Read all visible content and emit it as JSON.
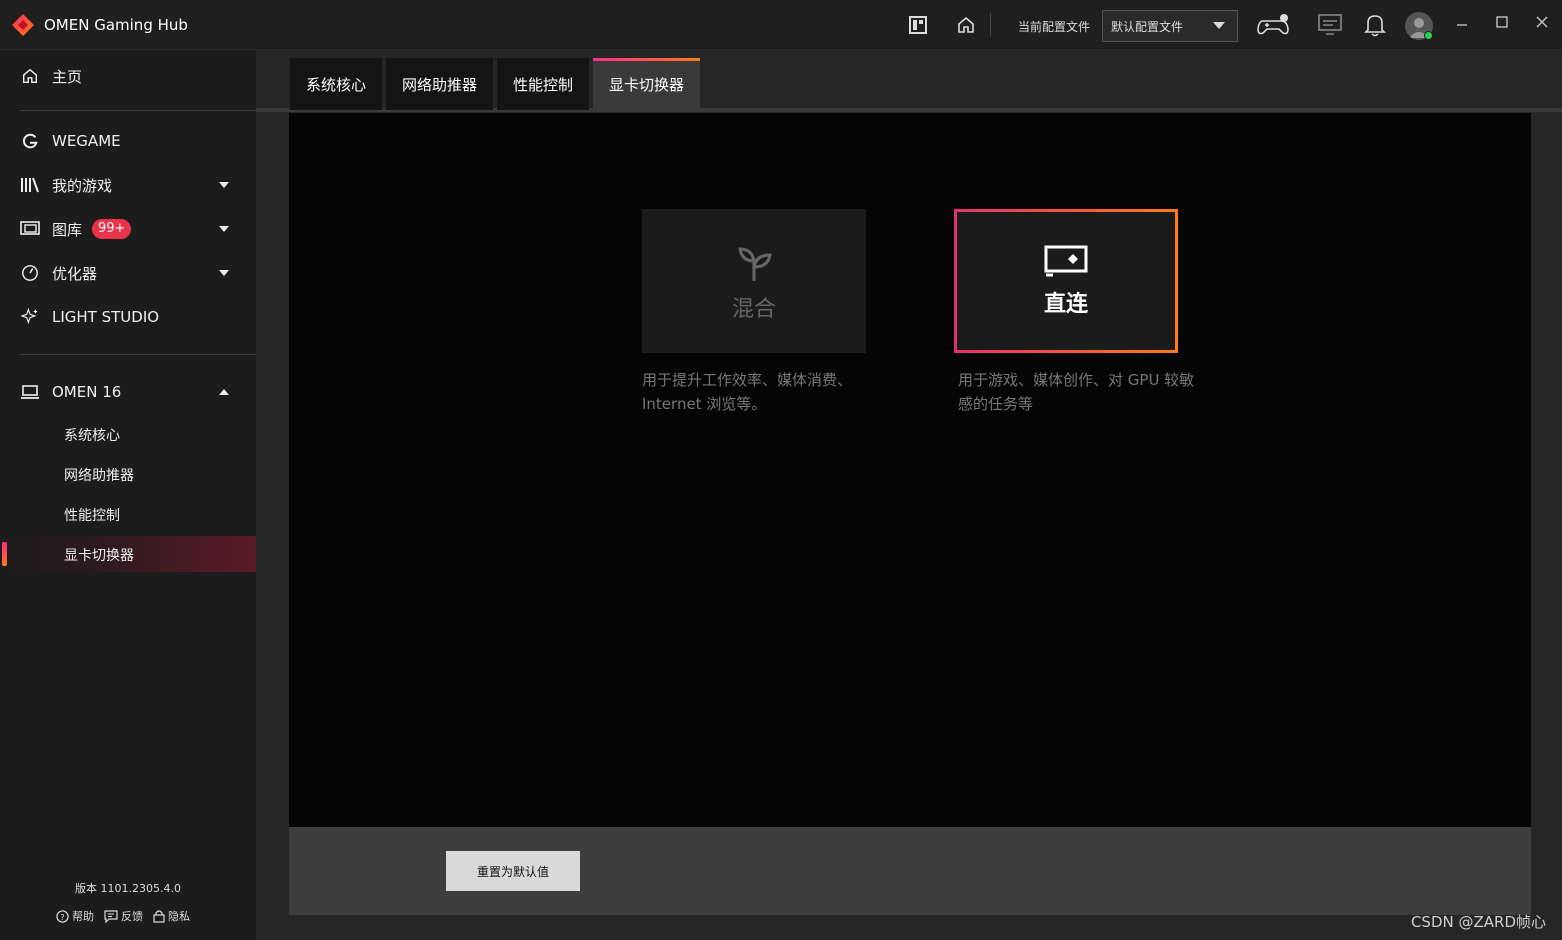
{
  "app": {
    "title": "OMEN Gaming Hub"
  },
  "header": {
    "profile_label": "当前配置文件",
    "profile_value": "默认配置文件"
  },
  "sidebar": {
    "home": "主页",
    "items": [
      {
        "label": "WEGAME"
      },
      {
        "label": "我的游戏"
      },
      {
        "label": "图库",
        "badge": "99+"
      },
      {
        "label": "优化器"
      },
      {
        "label": "LIGHT STUDIO"
      }
    ],
    "device": {
      "label": "OMEN 16",
      "sub_items": [
        "系统核心",
        "网络助推器",
        "性能控制",
        "显卡切换器"
      ]
    },
    "version": "版本 1101.2305.4.0",
    "footer": {
      "help": "帮助",
      "feedback": "反馈",
      "privacy": "隐私"
    }
  },
  "tabs": [
    "系统核心",
    "网络助推器",
    "性能控制",
    "显卡切换器"
  ],
  "modes": {
    "hybrid": {
      "name": "混合",
      "desc": "用于提升工作效率、媒体消费、Internet 浏览等。"
    },
    "direct": {
      "name": "直连",
      "desc": "用于游戏、媒体创作、对 GPU 较敏感的任务等"
    }
  },
  "reset_button": "重置为默认值",
  "watermark": "CSDN @ZARD帧心",
  "colors": {
    "accent_start": "#ff2d8a",
    "accent_end": "#ff7a1a",
    "badge": "#e8334a"
  }
}
